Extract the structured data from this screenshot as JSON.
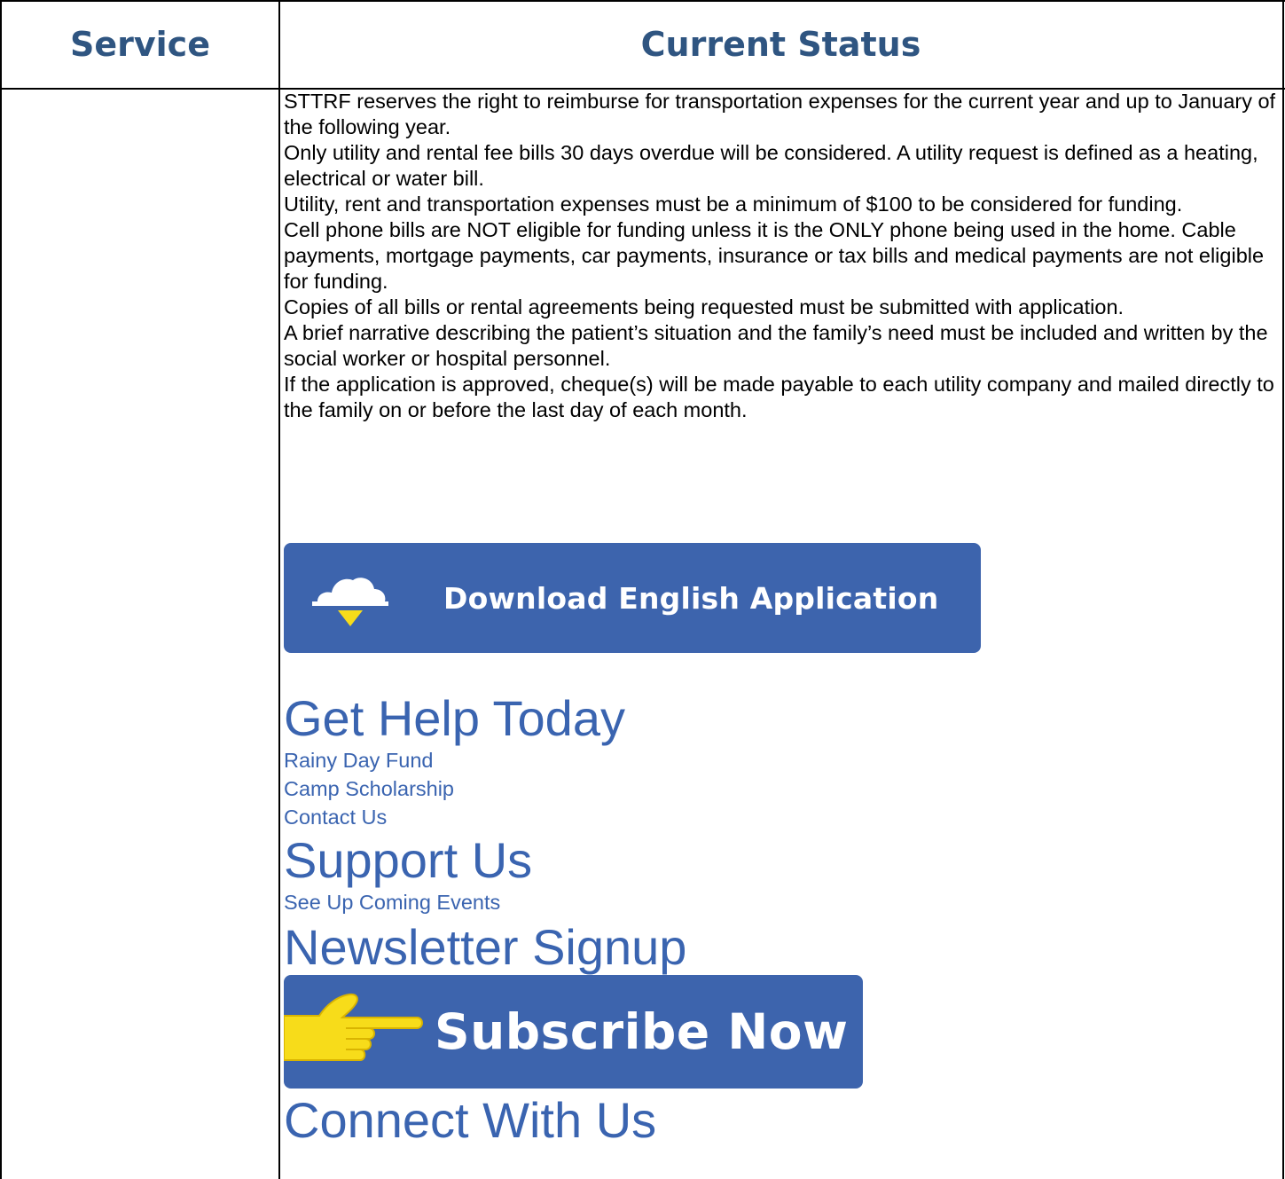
{
  "table": {
    "headers": {
      "service": "Service",
      "status": "Current Status"
    },
    "paragraphs": [
      "STTRF reserves the right to reimburse for transportation expenses for the current year and up to January of the following year.",
      "Only utility and rental fee bills 30 days overdue will be considered. A utility request is defined as a heating, electrical or water bill.",
      "Utility, rent and transportation expenses must be a minimum of $100 to be considered for funding.",
      "Cell phone bills are NOT eligible for funding unless it is the ONLY phone being used in the home. Cable payments, mortgage payments, car payments, insurance or tax bills and medical payments are not eligible for funding.",
      "Copies of all bills or rental agreements being requested must be submitted with application.",
      "A brief narrative describing the patient’s situation and the family’s need must be included and written by the social worker or hospital personnel.",
      "If the application is approved, cheque(s) will be made payable to each utility company and mailed directly to the family on or before the last day of each month."
    ]
  },
  "download_button": {
    "label": "Download English Application",
    "icon": "cloud-download-icon",
    "color": "#3d64ad"
  },
  "get_help": {
    "heading": "Get Help Today",
    "links": [
      "Rainy Day Fund",
      "Camp Scholarship",
      "Contact Us"
    ]
  },
  "support": {
    "heading": "Support Us",
    "links": [
      "See Up Coming Events"
    ]
  },
  "newsletter": {
    "heading": "Newsletter Signup"
  },
  "subscribe_button": {
    "label": "Subscribe Now",
    "icon": "pointing-hand-icon",
    "color": "#3d64ad",
    "icon_color": "#f7dc1a"
  },
  "connect": {
    "heading": "Connect With Us"
  },
  "colors": {
    "header_text": "#2f5581",
    "link_text": "#3a64b0"
  }
}
